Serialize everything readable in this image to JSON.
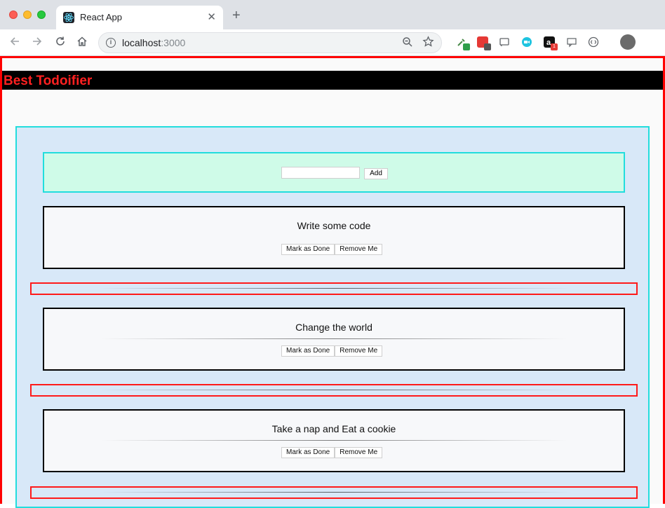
{
  "browser": {
    "tab_title": "React App",
    "tab_close": "✕",
    "new_tab": "+",
    "url_host": "localhost",
    "url_port": ":3000"
  },
  "app": {
    "title": "Best Todoifier"
  },
  "form": {
    "input_value": "",
    "add_label": "Add"
  },
  "todos": [
    {
      "text": "Write some code",
      "done_label": "Mark as Done",
      "remove_label": "Remove Me"
    },
    {
      "text": "Change the world",
      "done_label": "Mark as Done",
      "remove_label": "Remove Me"
    },
    {
      "text": "Take a nap and Eat a cookie",
      "done_label": "Mark as Done",
      "remove_label": "Remove Me"
    }
  ],
  "colors": {
    "page_border": "#ff0000",
    "header_bg": "#000000",
    "title_color": "#ff2020",
    "container_bg": "#d8e8f8",
    "container_border": "#22dddd",
    "form_bg": "#cffbe8",
    "card_border": "#000000",
    "divider_border": "#ff1a1a"
  },
  "icons": {
    "back": "back-arrow-icon",
    "forward": "forward-arrow-icon",
    "reload": "reload-icon",
    "home": "home-icon",
    "info": "info-icon",
    "zoom": "zoom-icon",
    "star": "bookmark-star-icon"
  }
}
